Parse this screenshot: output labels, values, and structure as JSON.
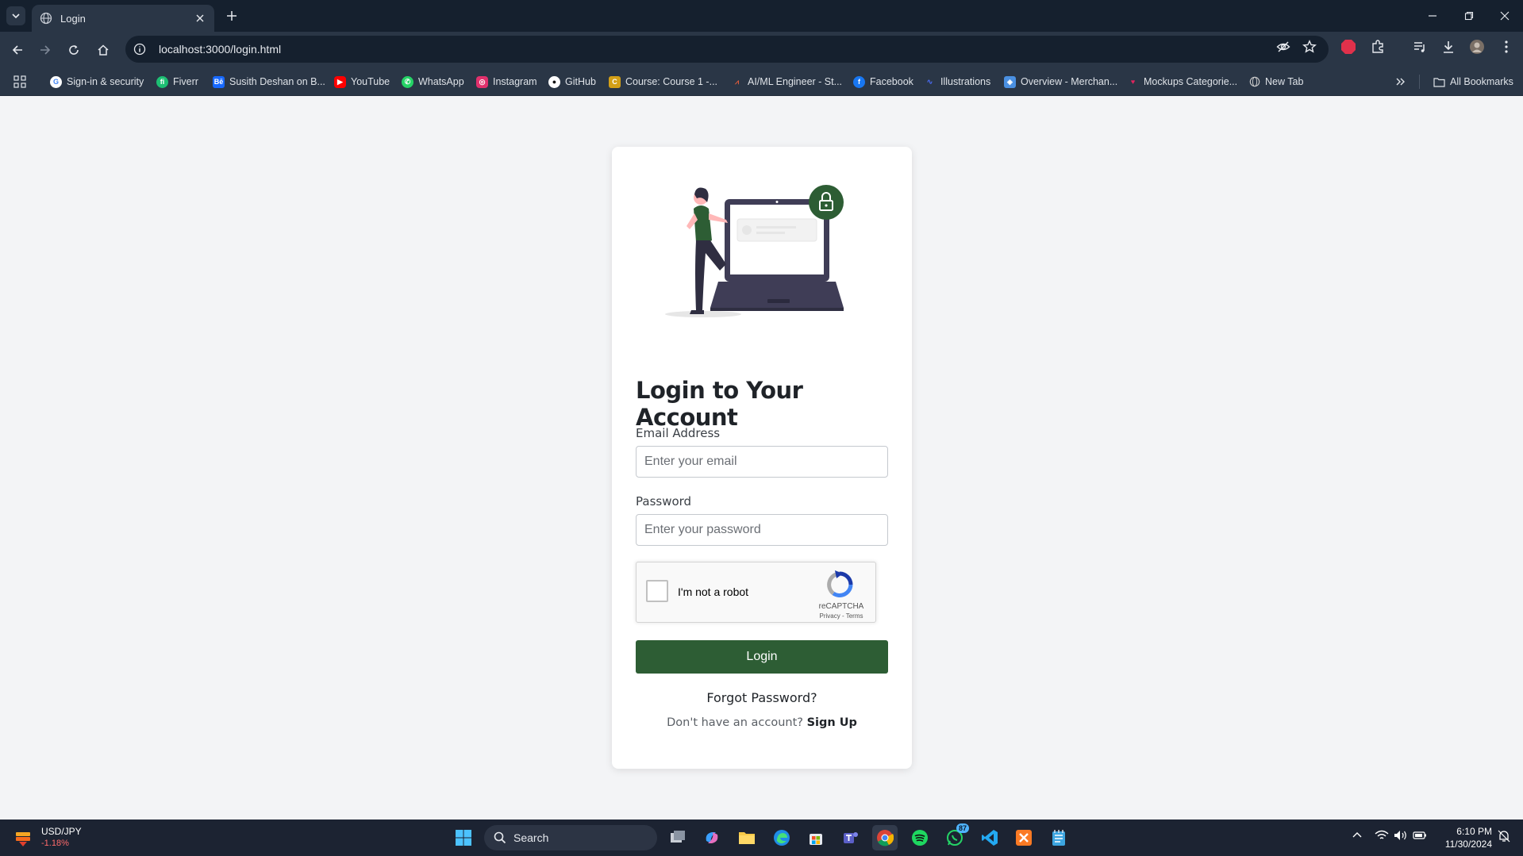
{
  "browser": {
    "tab": {
      "title": "Login"
    },
    "url": "localhost:3000/login.html",
    "bookmarks": [
      {
        "label": "Sign-in & security",
        "icon": "google-icon",
        "color": "#ffffff"
      },
      {
        "label": "Fiverr",
        "icon": "fiverr-icon",
        "color": "#1dbf73"
      },
      {
        "label": "Susith Deshan on B...",
        "icon": "behance-icon",
        "color": "#1769ff"
      },
      {
        "label": "YouTube",
        "icon": "youtube-icon",
        "color": "#ff0000"
      },
      {
        "label": "WhatsApp",
        "icon": "whatsapp-icon",
        "color": "#25d366"
      },
      {
        "label": "Instagram",
        "icon": "instagram-icon",
        "color": "#e1306c"
      },
      {
        "label": "GitHub",
        "icon": "github-icon",
        "color": "#ffffff"
      },
      {
        "label": "Course: Course 1 -...",
        "icon": "course-icon",
        "color": "#d4a017"
      },
      {
        "label": "AI/ML Engineer - St...",
        "icon": "aiml-icon",
        "color": "#e05a3a"
      },
      {
        "label": "Facebook",
        "icon": "facebook-icon",
        "color": "#1877f2"
      },
      {
        "label": "Illustrations",
        "icon": "illustrations-icon",
        "color": "#4a6cf7"
      },
      {
        "label": "Overview - Merchan...",
        "icon": "merch-icon",
        "color": "#4a90e2"
      },
      {
        "label": "Mockups Categorie...",
        "icon": "mockups-icon",
        "color": "#e0245e"
      },
      {
        "label": "New Tab",
        "icon": "globe-icon",
        "color": "#cccccc"
      }
    ],
    "all_bookmarks": "All Bookmarks",
    "extension_badge": "ABP"
  },
  "page": {
    "heading": "Login to Your Account",
    "email": {
      "label": "Email Address",
      "placeholder": "Enter your email",
      "value": ""
    },
    "password": {
      "label": "Password",
      "placeholder": "Enter your password",
      "value": ""
    },
    "recaptcha": {
      "label": "I'm not a robot",
      "brand": "reCAPTCHA",
      "links": "Privacy - Terms"
    },
    "login_button": "Login",
    "forgot_password": "Forgot Password?",
    "signup_prompt": "Don't have an account?",
    "signup_link": "Sign Up",
    "accent_color": "#2d5d34"
  },
  "taskbar": {
    "ticker": {
      "symbol": "USD/JPY",
      "change": "-1.18%"
    },
    "search_label": "Search",
    "whatsapp_badge": "87",
    "time": "6:10 PM",
    "date": "11/30/2024"
  }
}
